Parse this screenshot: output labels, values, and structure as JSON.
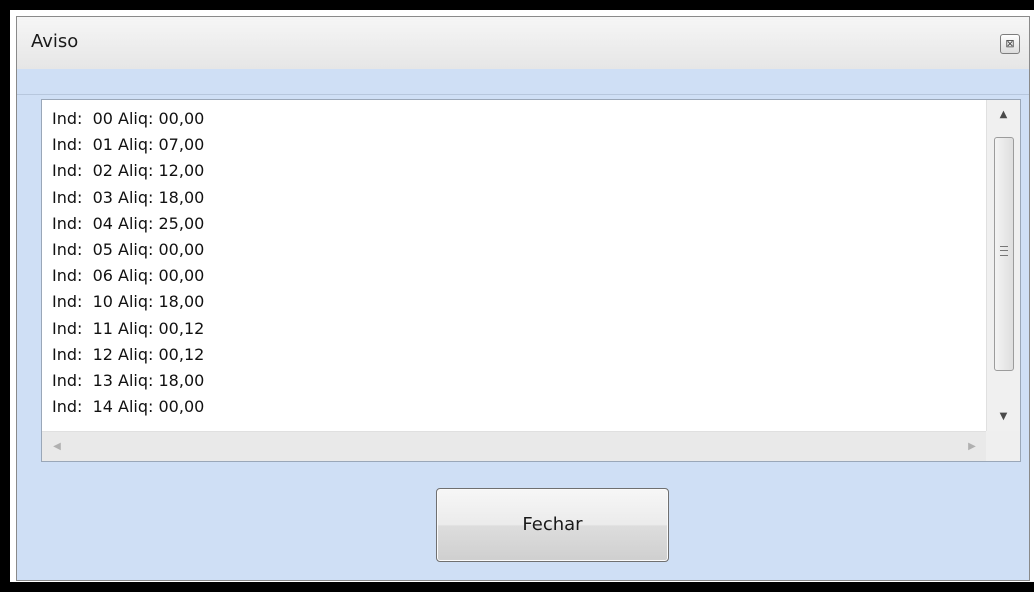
{
  "window": {
    "title": "Aviso",
    "close_icon": "close-icon"
  },
  "memo": {
    "lines": [
      "Ind:  00 Aliq: 00,00",
      "Ind:  01 Aliq: 07,00",
      "Ind:  02 Aliq: 12,00",
      "Ind:  03 Aliq: 18,00",
      "Ind:  04 Aliq: 25,00",
      "Ind:  05 Aliq: 00,00",
      "Ind:  06 Aliq: 00,00",
      "Ind:  10 Aliq: 18,00",
      "Ind:  11 Aliq: 00,12",
      "Ind:  12 Aliq: 00,12",
      "Ind:  13 Aliq: 18,00",
      "Ind:  14 Aliq: 00,00"
    ]
  },
  "buttons": {
    "close_label": "Fechar"
  },
  "colors": {
    "panel_blue": "#cfdff5",
    "frame_black": "#000000"
  }
}
